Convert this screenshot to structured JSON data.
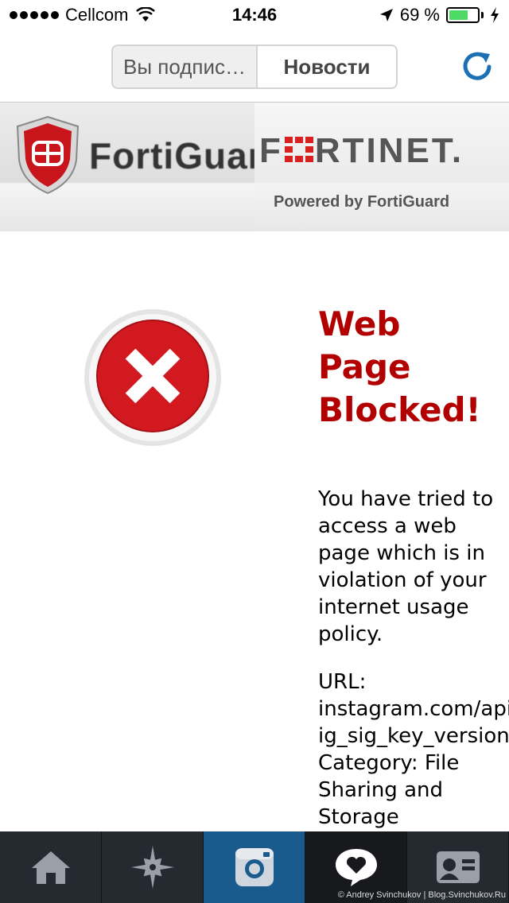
{
  "status_bar": {
    "carrier": "Cellcom",
    "time": "14:46",
    "battery_percent": "69 %",
    "battery_level": 0.69,
    "battery_color": "#4cd964"
  },
  "nav": {
    "segment_left": "Вы подпис…",
    "segment_right": "Новости",
    "refresh_icon": "refresh-icon",
    "accent_color": "#1a6fb5"
  },
  "banner": {
    "left_brand": "FortiGuard",
    "right_brand_prefix": "F",
    "right_brand_suffix": "RTINET.",
    "powered_by": "Powered by FortiGuard"
  },
  "blocked_page": {
    "heading_lines": [
      "Web",
      "Page",
      "Blocked!"
    ],
    "message": "You have tried to access a web page which is in violation of your internet usage policy.",
    "url_label": "URL:",
    "url_line1": "instagram.com/api",
    "url_line2": "ig_sig_key_version",
    "category_line1": "Category: File",
    "category_line2": "Sharing and",
    "category_line3": "Storage",
    "heading_color": "#b20000"
  },
  "tab_bar": {
    "tabs": [
      {
        "icon": "home-icon",
        "active": false
      },
      {
        "icon": "explore-star-icon",
        "active": false
      },
      {
        "icon": "camera-icon",
        "active": true
      },
      {
        "icon": "heart-bubble-icon",
        "active": false
      },
      {
        "icon": "profile-card-icon",
        "active": false
      }
    ],
    "active_color": "#1a5b8e",
    "watermark": "© Andrey Svinchukov | Blog.Svinchukov.Ru"
  }
}
